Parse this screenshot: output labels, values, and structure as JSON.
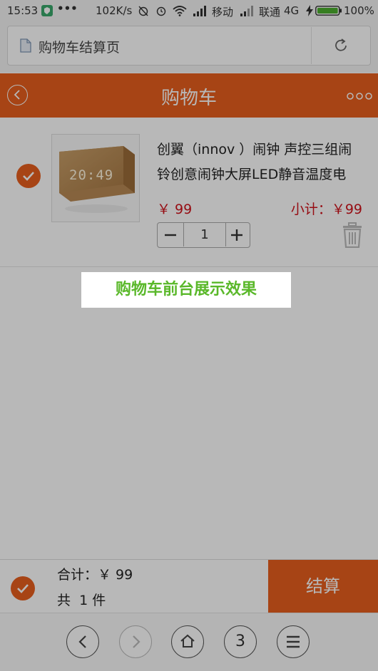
{
  "status_bar": {
    "time": "15:53",
    "dots": "•••",
    "speed": "102K/s",
    "carrier1": "移动",
    "carrier2": "联通",
    "network": "4G",
    "battery": "100%"
  },
  "url_bar": {
    "title": "购物车结算页",
    "page_icon": "document-icon",
    "reload_icon": "refresh-icon"
  },
  "header": {
    "title": "购物车",
    "back_icon": "back-arrow-icon",
    "more_icon": "more-dots-icon"
  },
  "cart": {
    "items": [
      {
        "checked": true,
        "name_line1": "创翼（innov ）闹钟 声控三组闹",
        "name_line2": "铃创意闹钟大屏LED静音温度电",
        "price": "￥ 99",
        "subtotal": "小计：￥99",
        "quantity": "1",
        "image_clock_text": "20:49"
      }
    ]
  },
  "caption": "购物车前台展示效果",
  "footer": {
    "total": "合计：￥ 99",
    "count": "共  1 件",
    "checkout_label": "结算"
  },
  "browser_nav": {
    "tab_count": "3"
  },
  "colors": {
    "brand_orange": "#e85f1e",
    "price_red": "#d0121b",
    "caption_green": "#5ab82a"
  }
}
